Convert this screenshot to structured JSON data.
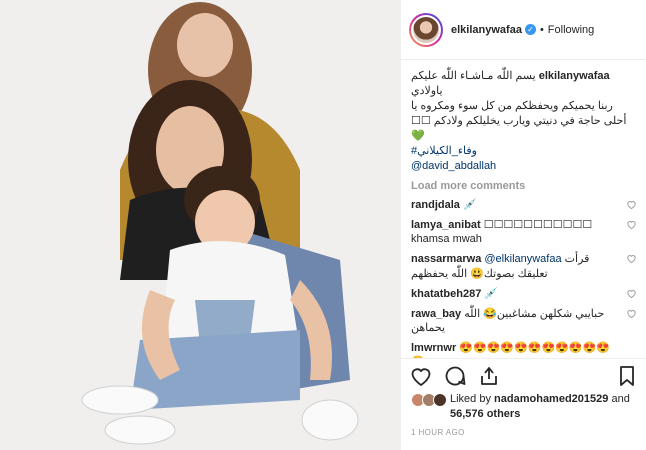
{
  "post": {
    "username": "elkilanywafaa",
    "verified_icon": "check",
    "dot": "•",
    "follow_label": "Following"
  },
  "caption": {
    "author": "elkilanywafaa",
    "line1": "يسم اللّٰه مـاشـاء اللّٰه عليكم",
    "line2": "ياولادي",
    "line3": "ربنا يحميكم ويحفظكم من كل سوء ومكروه يا",
    "line4": "أحلى حاجة في دنيتي ويارب يخليلكم ولادكم ☐☐",
    "heart": "💚",
    "hashtag": "#وفاء_الكيلاني",
    "mention": "@david_abdallah"
  },
  "load_more": "Load more comments",
  "comments": [
    {
      "user": "randjdala",
      "text": "💉"
    },
    {
      "user": "lamya_anibat",
      "text": "☐☐☐☐☐☐☐☐☐☐☐",
      "text2": "khamsa mwah"
    },
    {
      "user": "nassarmarwa",
      "mention": "@elkilanywafaa",
      "text": "قرأت",
      "text2": "تعليقك بصوتك😃 اللّٰه يحفظهم"
    },
    {
      "user": "khatatbeh287",
      "text": "💉"
    },
    {
      "user": "rawa_bay",
      "text": "حبايبي شكلهن مشاغبين😂 اللّٰه",
      "text2": "يحماهن"
    },
    {
      "user": "lmwrnwr",
      "text": "😍😍😍😍😍😍😍😍😍😍😍😍"
    }
  ],
  "likes": {
    "prefix": "Liked by",
    "user": "nadamohamed201529",
    "and": "and",
    "count": "56,576 others"
  },
  "timestamp": "1 HOUR AGO",
  "colors": {
    "link": "#003569",
    "verified": "#3897f0",
    "muted": "#999999",
    "green": "#28c840"
  }
}
